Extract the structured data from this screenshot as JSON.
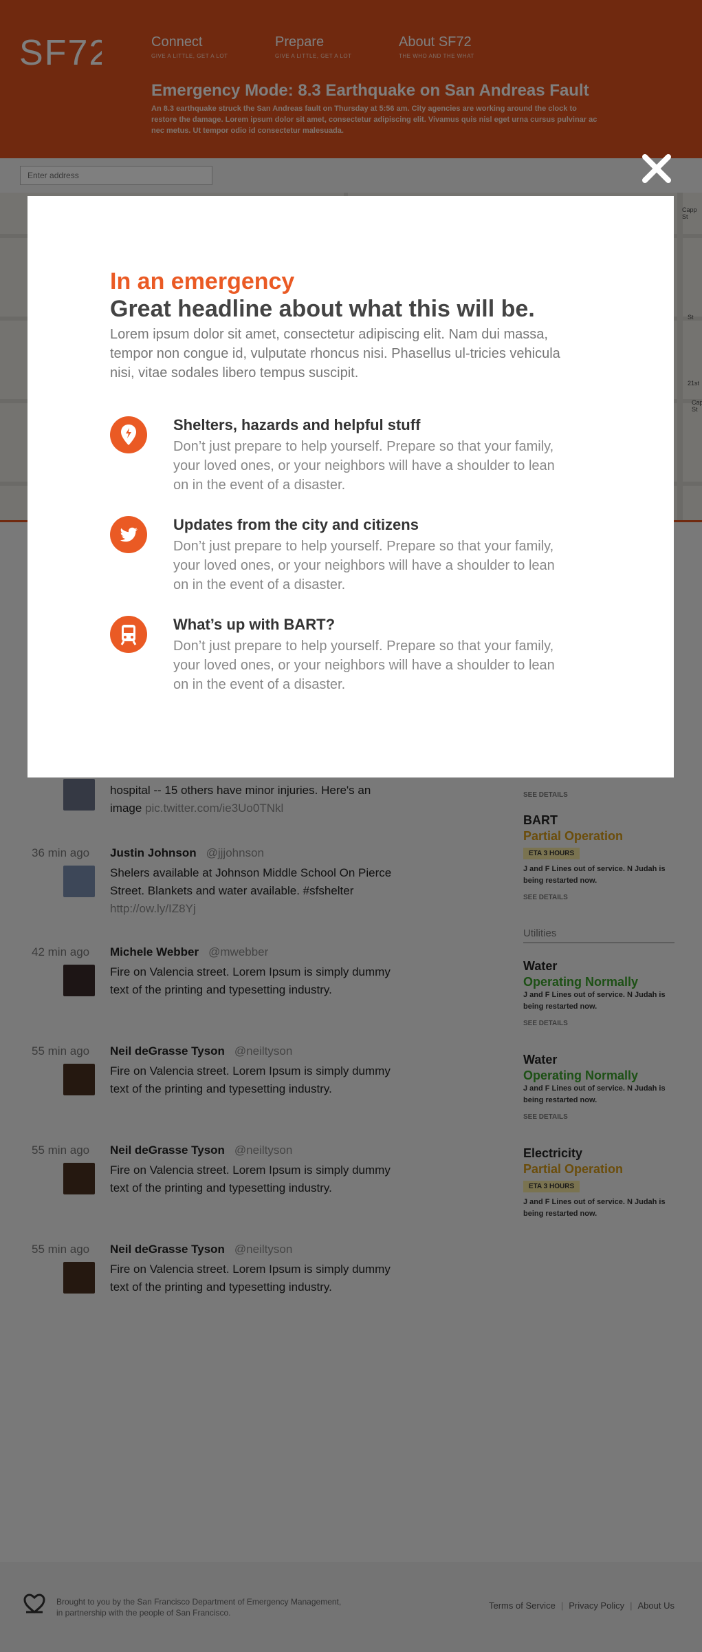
{
  "header": {
    "logo_text": "SF72",
    "nav": [
      {
        "title": "Connect",
        "subtitle": "GIVE A LITTLE, GET A LOT"
      },
      {
        "title": "Prepare",
        "subtitle": "GIVE A LITTLE, GET A LOT"
      },
      {
        "title": "About SF72",
        "subtitle": "THE WHO AND THE WHAT"
      }
    ],
    "emergency_title": "Emergency Mode: 8.3 Earthquake on San Andreas Fault",
    "emergency_body": "An 8.3 earthquake struck the San Andreas fault on Thursday at 5:56 am. City agencies are working around the clock to restore the damage. Lorem ipsum dolor sit amet, consectetur adipiscing elit. Vivamus quis nisl eget urna cursus pulvinar ac nec metus. Ut tempor odio id consectetur malesuada."
  },
  "address": {
    "placeholder": "Enter address"
  },
  "map": {
    "labels": [
      "Capp St",
      "St",
      "21st",
      "Capp St"
    ]
  },
  "feed": [
    {
      "time": "",
      "name": "",
      "handle": "",
      "text": "hospital -- 15 others have minor injuries. Here's an image",
      "link": "pic.twitter.com/ie3Uo0TNkl"
    },
    {
      "time": "36 min ago",
      "name": "Justin Johnson",
      "handle": "@jjjohnson",
      "text": "Shelers available at Johnson Middle School On Pierce Street. Blankets and water available. #sfshelter",
      "link": "http://ow.ly/IZ8Yj"
    },
    {
      "time": "42 min ago",
      "name": "Michele Webber",
      "handle": "@mwebber",
      "text": "Fire on Valencia street. Lorem Ipsum is simply dummy text of the printing and typesetting industry.",
      "link": ""
    },
    {
      "time": "55 min ago",
      "name": "Neil deGrasse Tyson",
      "handle": "@neiltyson",
      "text": "Fire on Valencia street. Lorem Ipsum is simply dummy text of the printing and typesetting industry.",
      "link": ""
    },
    {
      "time": "55 min ago",
      "name": "Neil deGrasse Tyson",
      "handle": "@neiltyson",
      "text": "Fire on Valencia street. Lorem Ipsum is simply dummy text of the printing and typesetting industry.",
      "link": ""
    },
    {
      "time": "55 min ago",
      "name": "Neil deGrasse Tyson",
      "handle": "@neiltyson",
      "text": "Fire on Valencia street. Lorem Ipsum is simply dummy text of the printing and typesetting industry.",
      "link": ""
    }
  ],
  "sidebar": {
    "top_more": "SEE DETAILS",
    "utilities_heading": "Utilities",
    "items": [
      {
        "name": "BART",
        "status": "Partial Operation",
        "status_color": "#d79a16",
        "eta": "ETA  3 HOURS",
        "desc": "J and F Lines out of service. N Judah is being restarted now.",
        "more": "SEE DETAILS"
      },
      {
        "name": "Water",
        "status": "Operating Normally",
        "status_color": "#3aa12a",
        "eta": "",
        "desc": "J and F Lines out of service. N Judah is being restarted now.",
        "more": "SEE DETAILS"
      },
      {
        "name": "Water",
        "status": "Operating Normally",
        "status_color": "#3aa12a",
        "eta": "",
        "desc": "J and F Lines out of service. N Judah is being restarted now.",
        "more": "SEE DETAILS"
      },
      {
        "name": "Electricity",
        "status": "Partial Operation",
        "status_color": "#d79a16",
        "eta": "ETA  3 HOURS",
        "desc": "J and F Lines out of service. N Judah is being restarted now.",
        "more": ""
      }
    ]
  },
  "footer": {
    "credit": "Brought to you by the San Francisco Department of Emergency Management, in partnership with the people of San Francisco.",
    "links": [
      "Terms of Service",
      "Privacy Policy",
      "About Us"
    ]
  },
  "modal": {
    "kicker": "In an emergency",
    "headline": "Great headline about what this will be.",
    "lead": "Lorem ipsum dolor sit amet, consectetur adipiscing elit. Nam dui massa, tempor non congue id, vulputate rhoncus nisi. Phasellus ul-tricies vehicula nisi, vitae sodales libero tempus suscipit.",
    "features": [
      {
        "icon": "map-pin-icon",
        "title": "Shelters, hazards and helpful stuff",
        "desc": "Don’t just prepare to help yourself. Prepare so that your family, your loved ones, or your neighbors will have a shoulder to lean on in the event of a disaster."
      },
      {
        "icon": "twitter-bird-icon",
        "title": "Updates from the city and citizens",
        "desc": "Don’t just prepare to help yourself. Prepare so that your family, your loved ones, or your neighbors will have a shoulder to lean on in the event of a disaster."
      },
      {
        "icon": "train-icon",
        "title": "What’s up with BART?",
        "desc": "Don’t just prepare to help yourself. Prepare so that your family, your loved ones, or your neighbors will have a shoulder to lean on in the event of a disaster."
      }
    ]
  },
  "colors": {
    "brand": "#e0531f",
    "accent": "#ea5a24"
  }
}
